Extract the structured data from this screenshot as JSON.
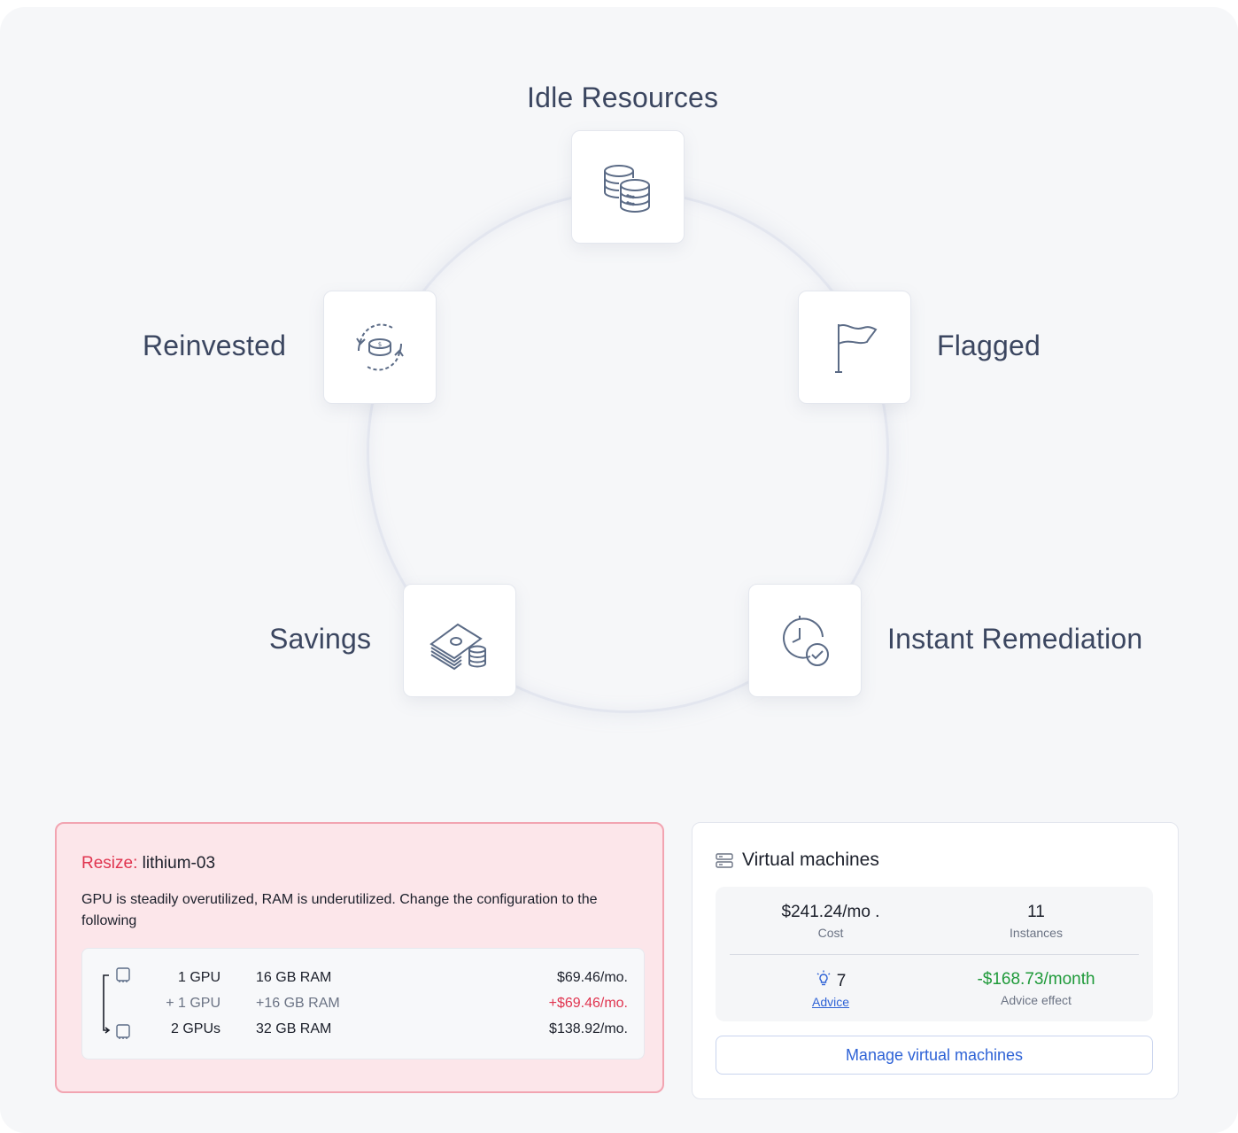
{
  "cycle": {
    "nodes": [
      {
        "label": "Idle Resources",
        "icon": "database-stack-icon"
      },
      {
        "label": "Flagged",
        "icon": "flag-icon"
      },
      {
        "label": "Instant Remediation",
        "icon": "clock-check-icon"
      },
      {
        "label": "Savings",
        "icon": "money-stack-icon"
      },
      {
        "label": "Reinvested",
        "icon": "coin-cycle-icon"
      }
    ]
  },
  "resize": {
    "keyword": "Resize:",
    "target": "lithium-03",
    "description": "GPU is steadily overutilized, RAM is underutilized. Change the configuration to the following",
    "rows": [
      {
        "gpu": "1 GPU",
        "ram": "16 GB RAM",
        "price": "$69.46/mo."
      },
      {
        "gpu": "+ 1 GPU",
        "ram": "+16 GB RAM",
        "price": "+$69.46/mo."
      },
      {
        "gpu": "2 GPUs",
        "ram": "32 GB RAM",
        "price": "$138.92/mo."
      }
    ]
  },
  "vm": {
    "title": "Virtual machines",
    "cost_value": "$241.24/mo .",
    "cost_label": "Cost",
    "instances_value": "11",
    "instances_label": "Instances",
    "advice_value": "7",
    "advice_label": "Advice",
    "effect_value": "-$168.73/month",
    "effect_label": "Advice effect",
    "manage_button": "Manage virtual machines"
  },
  "colors": {
    "accent_blue": "#2f63d6",
    "alert_red": "#e0344f",
    "positive_green": "#1f9a3a",
    "icon_stroke": "#5b6b86"
  }
}
